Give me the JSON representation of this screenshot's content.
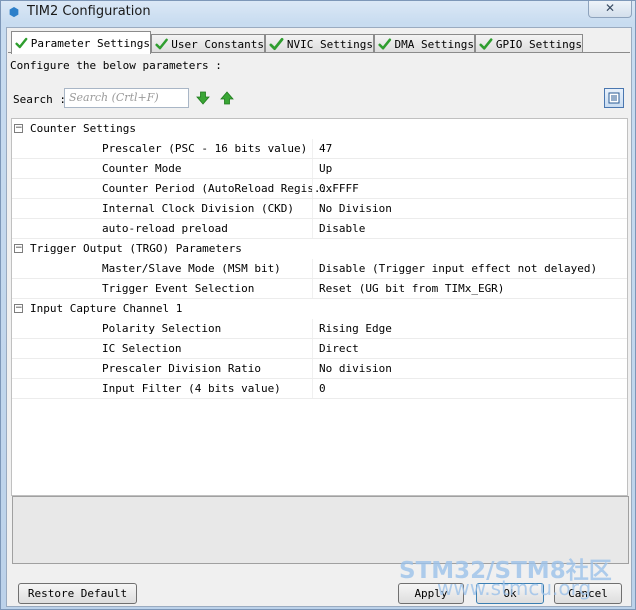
{
  "window": {
    "title": "TIM2 Configuration",
    "close_glyph": "✕"
  },
  "tabs": [
    {
      "label": "Parameter Settings",
      "active": true,
      "icon": "green-check-icon"
    },
    {
      "label": "User Constants",
      "active": false,
      "icon": "green-check-icon"
    },
    {
      "label": "NVIC Settings",
      "active": false,
      "icon": "green-check-icon"
    },
    {
      "label": "DMA Settings",
      "active": false,
      "icon": "green-check-icon"
    },
    {
      "label": "GPIO Settings",
      "active": false,
      "icon": "green-check-icon"
    }
  ],
  "panel": {
    "intro": "Configure the below parameters :",
    "search_label": "Search :",
    "search_placeholder": "Search (Crtl+F)"
  },
  "groups": [
    {
      "title": "Counter Settings",
      "toggle": "−",
      "params": [
        {
          "name": "Prescaler (PSC - 16 bits value)",
          "value": "47"
        },
        {
          "name": "Counter Mode",
          "value": "Up"
        },
        {
          "name": "Counter Period (AutoReload Regis...",
          "value": "0xFFFF"
        },
        {
          "name": "Internal Clock Division (CKD)",
          "value": "No Division"
        },
        {
          "name": "auto-reload preload",
          "value": "Disable"
        }
      ]
    },
    {
      "title": "Trigger Output (TRGO) Parameters",
      "toggle": "−",
      "params": [
        {
          "name": "Master/Slave Mode (MSM bit)",
          "value": "Disable (Trigger input effect not delayed)"
        },
        {
          "name": "Trigger Event Selection",
          "value": "Reset (UG bit from TIMx_EGR)"
        }
      ]
    },
    {
      "title": "Input Capture Channel 1",
      "toggle": "−",
      "params": [
        {
          "name": "Polarity Selection",
          "value": "Rising Edge"
        },
        {
          "name": "IC Selection",
          "value": "Direct"
        },
        {
          "name": "Prescaler Division Ratio",
          "value": "No division"
        },
        {
          "name": "Input Filter (4 bits value)",
          "value": "0"
        }
      ]
    }
  ],
  "buttons": {
    "restore": "Restore Default",
    "apply": "Apply",
    "ok": "Ok",
    "cancel": "Cancel"
  },
  "watermark": {
    "line1": "STM32/STM8社区",
    "line2": "www.stmcu.org"
  },
  "colors": {
    "check_green": "#2f9e2f",
    "arrow_green": "#3aa635"
  }
}
